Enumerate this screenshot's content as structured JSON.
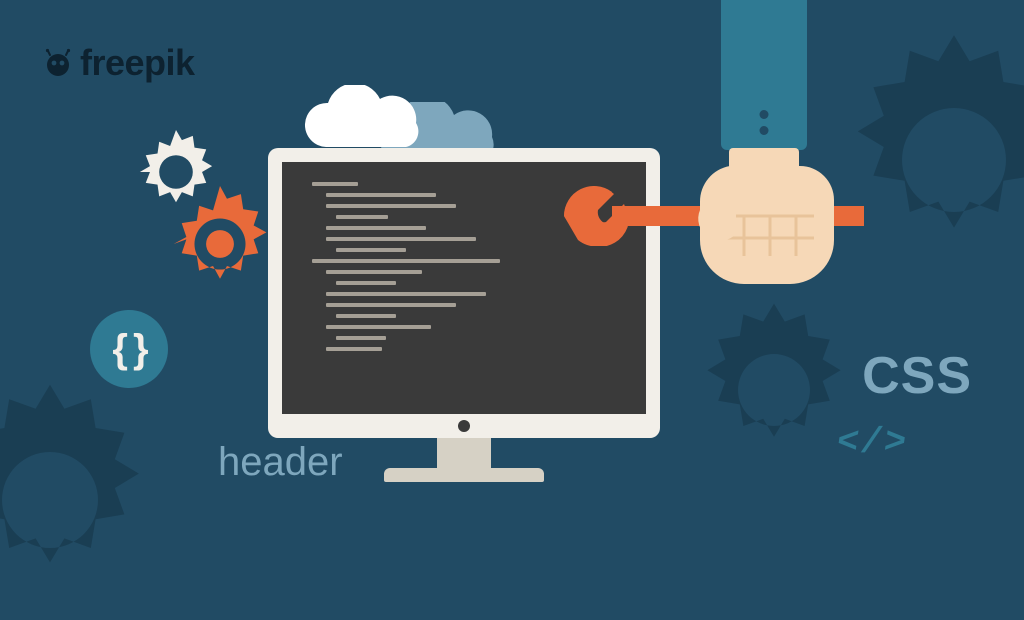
{
  "logo": {
    "text": "freepik"
  },
  "labels": {
    "header": "header",
    "css": "CSS",
    "braces": "{ }",
    "code_tag": "</>"
  },
  "icons": {
    "cloud_white": "cloud",
    "cloud_blue": "cloud",
    "gear_orange": "gear",
    "gear_white": "gear",
    "wrench": "wrench",
    "hand": "hand",
    "monitor": "monitor"
  },
  "colors": {
    "background": "#214b64",
    "bg_gear": "#1a3e53",
    "accent_orange": "#e86a3a",
    "accent_teal": "#2f7a93",
    "light_blue": "#7ea7bd",
    "off_white": "#f2efe9",
    "screen": "#3a3a3a",
    "line": "#a59f95"
  }
}
